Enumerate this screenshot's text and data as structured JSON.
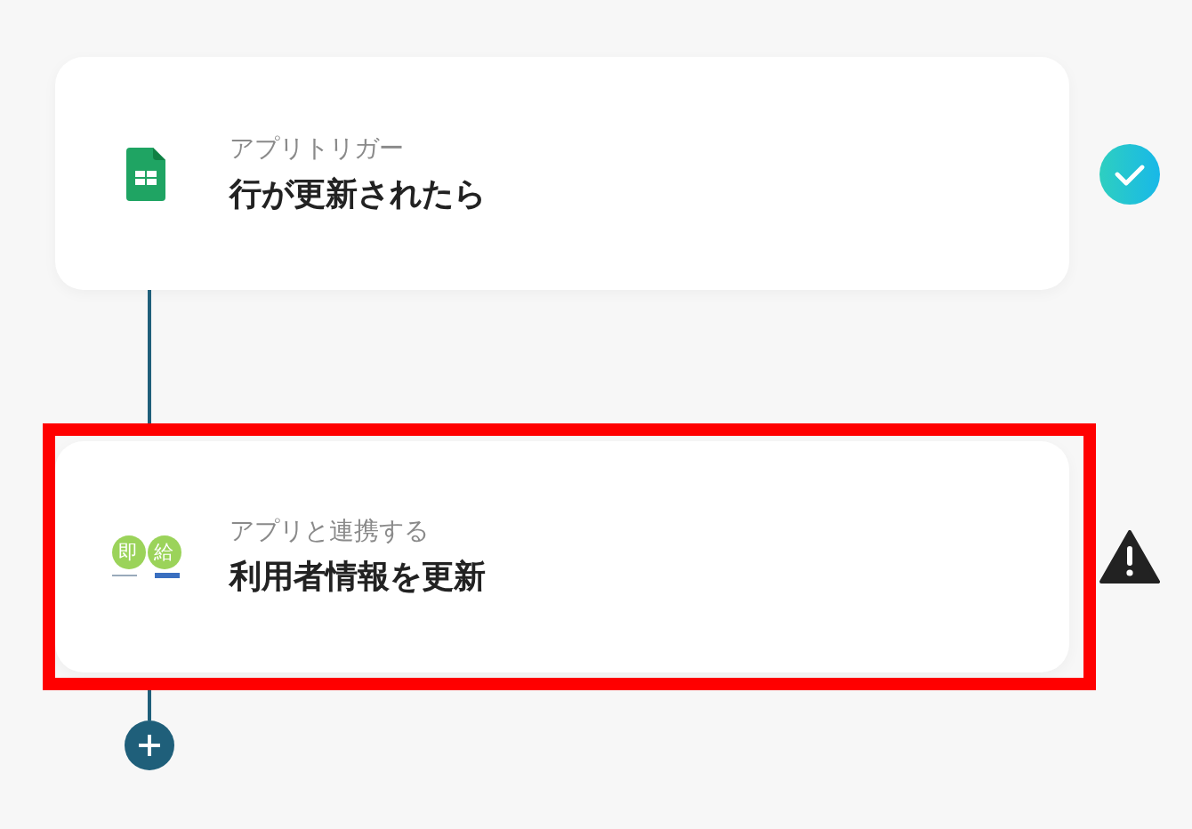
{
  "steps": [
    {
      "kind": "trigger",
      "label": "アプリトリガー",
      "title": "行が更新されたら",
      "error": false,
      "highlighted": false
    },
    {
      "kind": "action",
      "logo_chars": [
        "即",
        "給"
      ],
      "label": "アプリと連携する",
      "title": "利用者情報を更新",
      "error": true,
      "highlighted": true
    }
  ]
}
